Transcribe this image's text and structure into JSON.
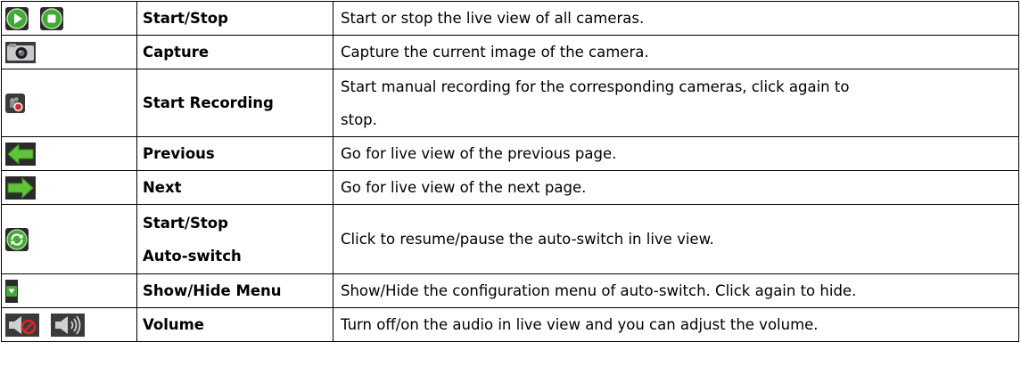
{
  "rows": [
    {
      "icons": [
        "play-icon",
        "stop-icon"
      ],
      "name": "Start/Stop",
      "description": "Start or stop the live view of all cameras."
    },
    {
      "icons": [
        "camera-icon"
      ],
      "name": "Capture",
      "description": "Capture the current image of the camera."
    },
    {
      "icons": [
        "record-icon"
      ],
      "name": "Start Recording",
      "description_lines": [
        "Start manual recording for the corresponding cameras, click again to",
        "stop."
      ]
    },
    {
      "icons": [
        "arrow-left-icon"
      ],
      "name": "Previous",
      "description": "Go for live view of the previous page."
    },
    {
      "icons": [
        "arrow-right-icon"
      ],
      "name": "Next",
      "description": "Go for live view of the next page."
    },
    {
      "icons": [
        "refresh-icon"
      ],
      "name_lines": [
        "Start/Stop",
        "Auto-switch"
      ],
      "description": "Click to resume/pause the auto-switch in live view."
    },
    {
      "icons": [
        "dropdown-icon"
      ],
      "name": "Show/Hide Menu",
      "description": "Show/Hide the configuration menu of auto-switch. Click again to hide."
    },
    {
      "icons": [
        "mute-icon",
        "speaker-icon"
      ],
      "name": "Volume",
      "description": "Turn off/on the audio in live view and you can adjust the volume."
    }
  ],
  "colors": {
    "green": "#43a838",
    "dark": "#2b2b2b",
    "red": "#d9262a",
    "gray": "#9a9a9a"
  }
}
